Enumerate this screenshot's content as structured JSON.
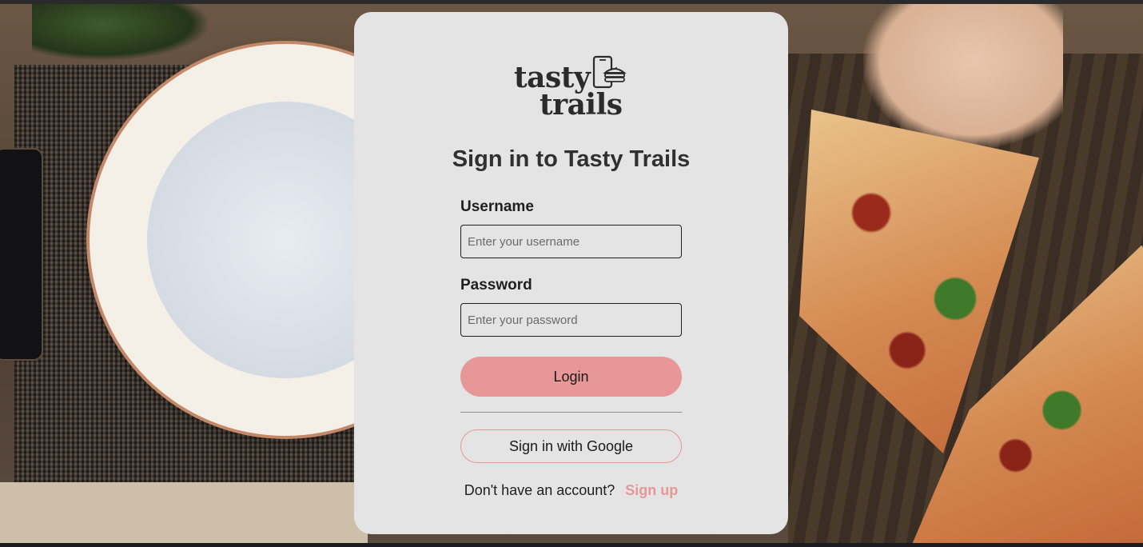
{
  "brand": {
    "logo_line1": "tasty",
    "logo_line2": "trails",
    "accent_color": "#e79797"
  },
  "login": {
    "title": "Sign in to Tasty Trails",
    "username_label": "Username",
    "username_placeholder": "Enter your username",
    "password_label": "Password",
    "password_placeholder": "Enter your password",
    "login_button": "Login",
    "google_button": "Sign in with Google",
    "signup_prompt": "Don't have an account?",
    "signup_link": "Sign up"
  },
  "background": {
    "icon": "pizza-table-photo"
  }
}
